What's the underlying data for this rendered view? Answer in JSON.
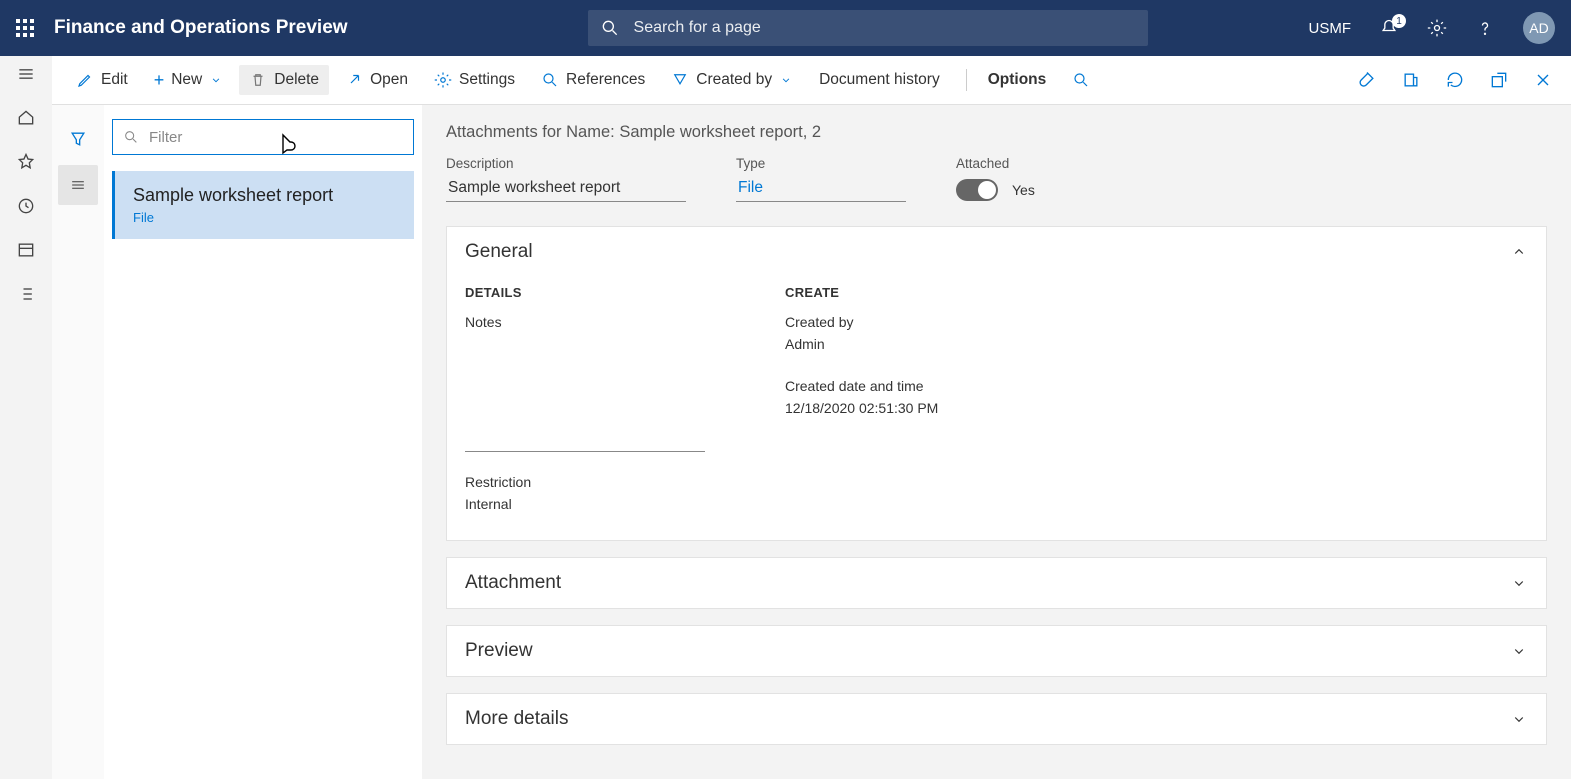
{
  "suite": {
    "title": "Finance and Operations Preview"
  },
  "search": {
    "placeholder": "Search for a page"
  },
  "topright": {
    "company": "USMF",
    "notifications_badge": "1",
    "avatar_initials": "AD"
  },
  "actions": {
    "edit": "Edit",
    "new": "New",
    "delete": "Delete",
    "open": "Open",
    "options": "Options",
    "settings": "Settings",
    "references": "References",
    "created_by": "Created by",
    "doc_history": "Document history"
  },
  "list": {
    "filter_placeholder": "Filter",
    "items": [
      {
        "title": "Sample worksheet report",
        "sub": "File"
      }
    ]
  },
  "detail": {
    "breadcrumb": "Attachments for Name: Sample worksheet report, 2",
    "description_label": "Description",
    "description": "Sample worksheet report",
    "type_label": "Type",
    "type": "File",
    "attached_label": "Attached",
    "attached_value": "Yes",
    "sections": {
      "general": {
        "title": "General",
        "details_hdr": "DETAILS",
        "notes_label": "Notes",
        "notes": "",
        "restriction_label": "Restriction",
        "restriction": "Internal",
        "create_hdr": "CREATE",
        "created_by_label": "Created by",
        "created_by": "Admin",
        "created_dt_label": "Created date and time",
        "created_dt": "12/18/2020 02:51:30 PM"
      },
      "attachment": {
        "title": "Attachment"
      },
      "preview": {
        "title": "Preview"
      },
      "more": {
        "title": "More details"
      }
    }
  }
}
